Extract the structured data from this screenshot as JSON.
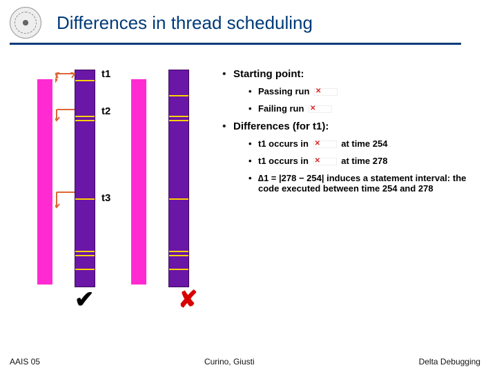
{
  "header": {
    "title": "Differences in thread scheduling"
  },
  "figure": {
    "t1": "t1",
    "t2": "t2",
    "t3": "t3",
    "check": "✔",
    "cross": "✘"
  },
  "notes": {
    "starting": "Starting point:",
    "passing": "Passing run",
    "failing": "Failing run",
    "diffs": "Differences (for t1):",
    "occ_pass_a": "t1 occurs in",
    "occ_pass_b": "at time 254",
    "occ_fail_a": "t1 occurs in",
    "occ_fail_b": "at time 278",
    "delta": "∆1 = |278 − 254| induces a statement interval: the code executed between time 254 and 278"
  },
  "footer": {
    "left": "AAIS 05",
    "center": "Curino, Giusti",
    "right": "Delta Debugging"
  }
}
